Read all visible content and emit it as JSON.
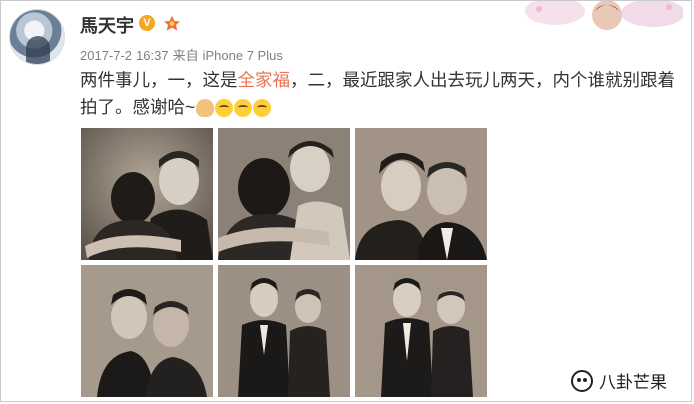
{
  "user": {
    "name": "馬天宇",
    "verified_mark": "V"
  },
  "meta": {
    "date": "2017-7-2",
    "time": "16:37",
    "source_prefix": "来自",
    "source": "iPhone 7 Plus"
  },
  "post": {
    "text_before": "两件事儿，一，这是",
    "highlight": "全家福",
    "text_after": "，二，最近跟家人出去玩儿两天，内个谁就别跟着拍了。感谢哈~"
  },
  "photos": [
    {
      "scene": "hug-side"
    },
    {
      "scene": "hug-smile"
    },
    {
      "scene": "cheek-rest"
    },
    {
      "scene": "forehead"
    },
    {
      "scene": "standing-pair"
    },
    {
      "scene": "standing-pair-2"
    }
  ],
  "watermark": {
    "text": "八卦芒果"
  },
  "colors": {
    "accent": "#eb7350",
    "text": "#333333",
    "meta": "#808080",
    "photo_tone": "#8a7f74"
  },
  "icons": [
    "verified-icon",
    "vip-icon",
    "emoji-hands-icon",
    "emoji-tongue-icon",
    "emoji-laugh-icon",
    "wechat-icon"
  ]
}
